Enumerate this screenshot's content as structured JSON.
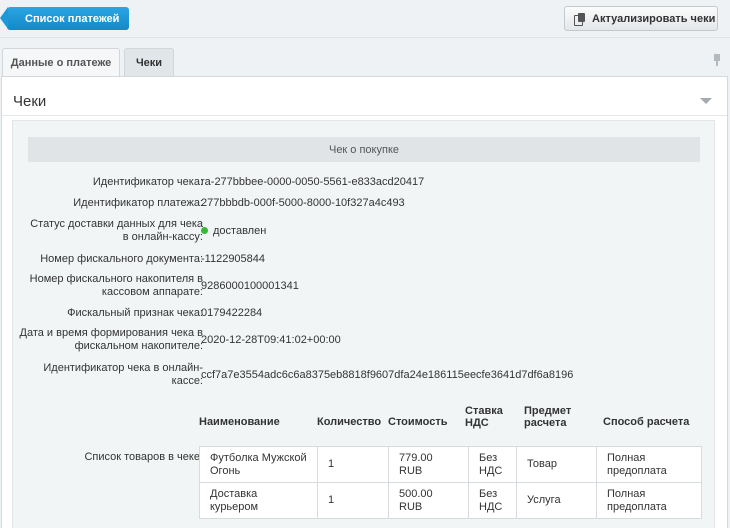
{
  "toolbar": {
    "back_label": "Список платежей",
    "refresh_label": "Актуализировать чеки"
  },
  "tabs": [
    {
      "label": "Данные о платеже"
    },
    {
      "label": "Чеки"
    }
  ],
  "panel": {
    "title": "Чеки",
    "section_title": "Чек о покупке"
  },
  "receipt": {
    "fields": [
      {
        "label": "Идентификатор чека:",
        "value": "ra-277bbbee-0000-0050-5561-e833acd20417"
      },
      {
        "label": "Идентификатор платежа:",
        "value": "277bbbdb-000f-5000-8000-10f327a4c493"
      },
      {
        "label": "Статус доставки данных для чека в онлайн-кассу:",
        "value": "доставлен"
      },
      {
        "label": "Номер фискального документа:",
        "value": "-1122905844"
      },
      {
        "label": "Номер фискального накопителя в кассовом аппарате:",
        "value": "9286000100001341"
      },
      {
        "label": "Фискальный признак чека:",
        "value": "0179422284"
      },
      {
        "label": "Дата и время формирования чека в фискальном накопителе:",
        "value": "2020-12-28T09:41:02+00:00"
      },
      {
        "label": "Идентификатор чека в онлайн-кассе:",
        "value": "ccf7a7e3554adc6c6a8375eb8818f9607dfa24e186115eecfe3641d7df6a8196"
      }
    ],
    "status_color": "#3cb53c",
    "goods_label": "Список товаров в чеке:",
    "goods_headers": [
      "Наименование",
      "Количество",
      "Стоимость",
      "Ставка НДС",
      "Предмет расчета",
      "Способ расчета"
    ],
    "goods": [
      {
        "name": "Футболка Мужской Огонь",
        "qty": "1",
        "price": "779.00 RUB",
        "vat": "Без НДС",
        "subject": "Товар",
        "method": "Полная предоплата"
      },
      {
        "name": "Доставка курьером",
        "qty": "1",
        "price": "500.00 RUB",
        "vat": "Без НДС",
        "subject": "Услуга",
        "method": "Полная предоплата"
      }
    ]
  }
}
